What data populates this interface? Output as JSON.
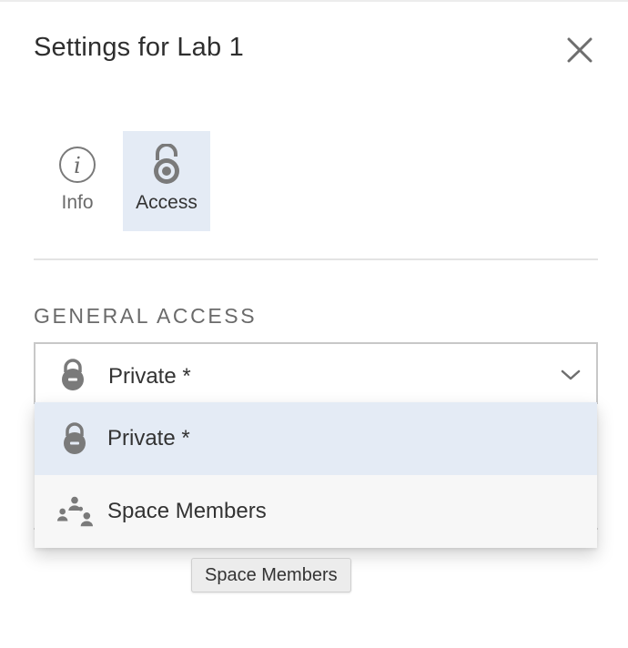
{
  "header": {
    "title": "Settings for Lab 1",
    "close_icon": "close-icon"
  },
  "tabs": [
    {
      "label": "Info",
      "icon": "info-icon",
      "active": false
    },
    {
      "label": "Access",
      "icon": "lock-open-icon",
      "active": true
    }
  ],
  "general_access": {
    "heading": "GENERAL ACCESS",
    "selected_value": "Private *",
    "selected_icon": "lock-icon",
    "options": [
      {
        "label": "Private *",
        "icon": "lock-icon",
        "highlighted": true
      },
      {
        "label": "Space Members",
        "icon": "people-icon",
        "highlighted": false
      }
    ]
  },
  "tooltip": {
    "text": "Space Members"
  },
  "colors": {
    "highlight": "#e4ebf5",
    "icon_gray": "#7a7a7a",
    "menu_bg": "#f7f7f7"
  }
}
